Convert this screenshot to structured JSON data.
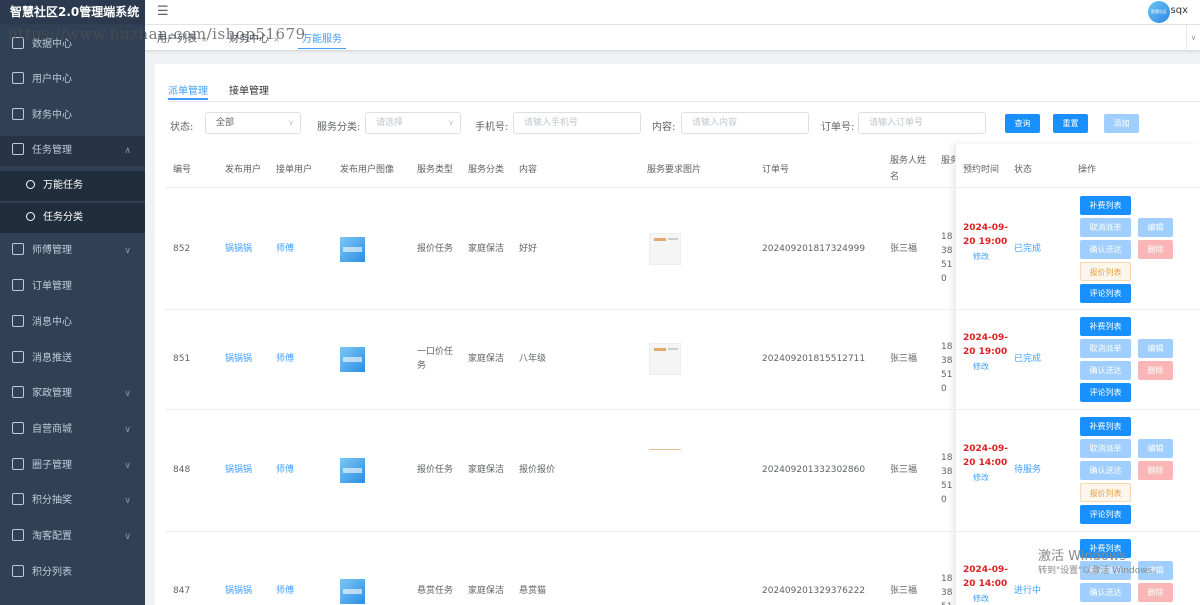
{
  "app": {
    "title": "智慧社区2.0管理端系统",
    "username": "sqx",
    "avatar_text": "智慧社区"
  },
  "sidebar": {
    "items": [
      {
        "label": "数据中心",
        "icon": "dashboard-icon"
      },
      {
        "label": "用户中心",
        "icon": "user-icon"
      },
      {
        "label": "财务中心",
        "icon": "wallet-icon"
      },
      {
        "label": "任务管理",
        "icon": "task-icon",
        "open": true
      },
      {
        "label": "万能任务",
        "sub": true
      },
      {
        "label": "任务分类",
        "sub": true
      },
      {
        "label": "师傅管理",
        "icon": "worker-icon"
      },
      {
        "label": "订单管理",
        "icon": "order-icon"
      },
      {
        "label": "消息中心",
        "icon": "message-icon"
      },
      {
        "label": "消息推送",
        "icon": "cloud-upload-icon"
      },
      {
        "label": "家政管理",
        "icon": "housekeeping-icon"
      },
      {
        "label": "自营商城",
        "icon": "shop-icon"
      },
      {
        "label": "圈子管理",
        "icon": "circle-icon"
      },
      {
        "label": "积分抽奖",
        "icon": "lottery-icon"
      },
      {
        "label": "淘客配置",
        "icon": "config-icon"
      },
      {
        "label": "积分列表",
        "icon": "list-icon"
      }
    ]
  },
  "tags": [
    {
      "label": "用户列表",
      "closable": true
    },
    {
      "label": "财务中心",
      "closable": true
    },
    {
      "label": "万能服务",
      "active": true
    }
  ],
  "watermark": "https://www.huzhan.com/ishop51679",
  "subtabs": [
    "派单管理",
    "接单管理"
  ],
  "filters": {
    "status_label": "状态:",
    "status_value": "全部",
    "category_label": "服务分类:",
    "category_placeholder": "请选择",
    "phone_label": "手机号:",
    "phone_placeholder": "请输入手机号",
    "content_label": "内容:",
    "content_placeholder": "请输入内容",
    "order_label": "订单号:",
    "order_placeholder": "请输入订单号",
    "query_btn": "查询",
    "reset_btn": "重置",
    "add_btn": "添加"
  },
  "table": {
    "headers": [
      "编号",
      "发布用户",
      "接单用户",
      "发布用户图像",
      "服务类型",
      "服务分类",
      "内容",
      "服务要求图片",
      "订单号",
      "服务人姓名",
      "服务人电话",
      "预约时间",
      "状态",
      "操作"
    ],
    "thumb_text": "智慧社区",
    "actions": {
      "bu": "补费列表",
      "cancel": "取消派单",
      "edit": "编辑",
      "confirm": "确认送达",
      "delete": "删除",
      "quote": "报价列表",
      "comment": "评论列表"
    },
    "modify": "修改",
    "rows": [
      {
        "id": "852",
        "pub": "锅锅锅",
        "rec": "师傅",
        "type": "报价任务",
        "cat": "家庭保洁",
        "content": "好好",
        "order": "202409201817324999",
        "name": "张三福",
        "phone": "1838510",
        "time1": "2024-09-",
        "time2": "20 19:00",
        "status": "已完成"
      },
      {
        "id": "851",
        "pub": "锅锅锅",
        "rec": "师傅",
        "type": "一口价任务",
        "cat": "家庭保洁",
        "content": "八年级",
        "order": "202409201815512711",
        "name": "张三福",
        "phone": "1838510",
        "time1": "2024-09-",
        "time2": "20 19:00",
        "status": "已完成"
      },
      {
        "id": "848",
        "pub": "锅锅锅",
        "rec": "师傅",
        "type": "报价任务",
        "cat": "家庭保洁",
        "content": "报价报价",
        "order": "202409201332302860",
        "name": "张三福",
        "phone": "1838510",
        "time1": "2024-09-",
        "time2": "20 14:00",
        "status": "待服务"
      },
      {
        "id": "847",
        "pub": "锅锅锅",
        "rec": "师傅",
        "type": "悬赏任务",
        "cat": "家庭保洁",
        "content": "悬赏猫",
        "order": "202409201329376222",
        "name": "张三福",
        "phone": "1838510",
        "time1": "2024-09-",
        "time2": "20 14:00",
        "status": "进行中"
      }
    ]
  },
  "os_overlay": {
    "line1": "激活 Windows",
    "line2": "转到\"设置\"以激活 Windows。"
  }
}
